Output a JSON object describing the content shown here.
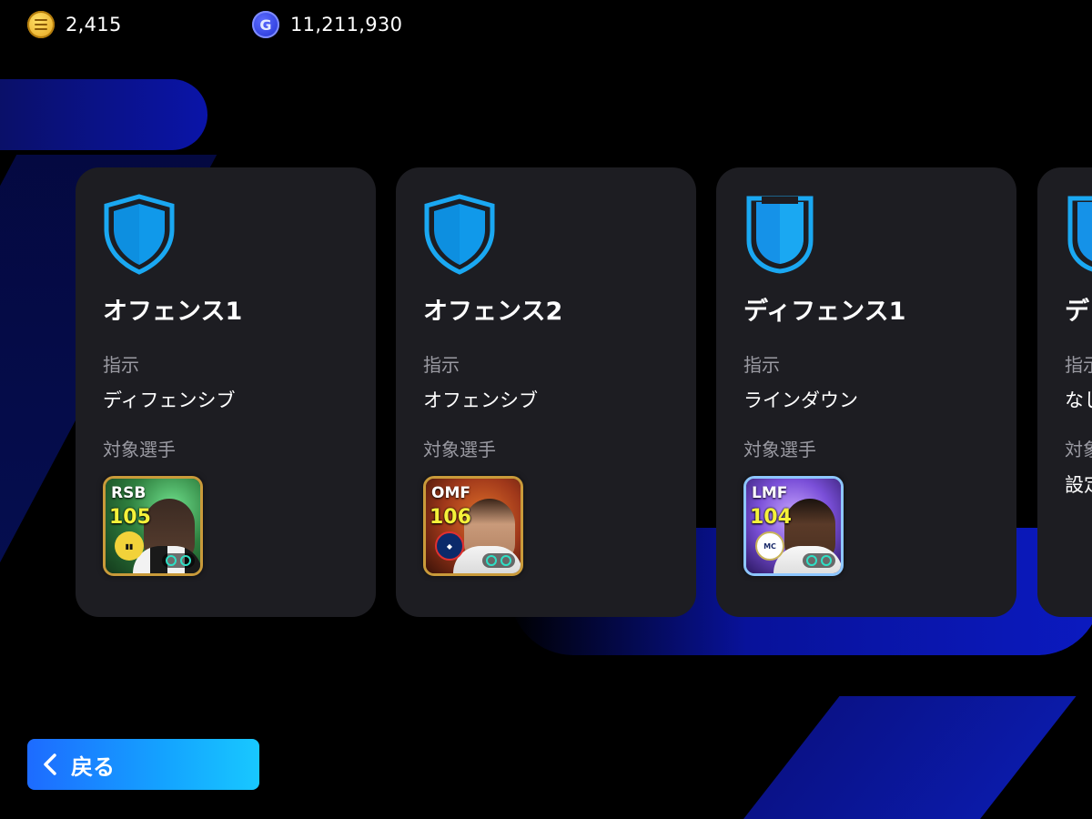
{
  "currency": {
    "coins": {
      "icon": "ecoin-icon",
      "amount": "2,415"
    },
    "gp": {
      "icon": "gp-icon",
      "amount": "11,211,930"
    }
  },
  "labels": {
    "instruction": "指示",
    "target_players": "対象選手"
  },
  "cards": [
    {
      "title": "オフェンス1",
      "shield_icon": "shield-outline-icon",
      "instruction_value": "ディフェンシブ",
      "player": {
        "position": "RSB",
        "rating": "105"
      }
    },
    {
      "title": "オフェンス2",
      "shield_icon": "shield-outline-icon",
      "instruction_value": "オフェンシブ",
      "player": {
        "position": "OMF",
        "rating": "106"
      }
    },
    {
      "title": "ディフェンス1",
      "shield_icon": "shield-solid-icon",
      "instruction_value": "ラインダウン",
      "player": {
        "position": "LMF",
        "rating": "104"
      }
    },
    {
      "title": "デ",
      "shield_icon": "shield-solid-icon",
      "instruction_value": "なし",
      "target_value": "設定"
    }
  ],
  "back_button": {
    "label": "戻る",
    "icon": "chevron-left-icon"
  },
  "colors": {
    "accent": "#14a4ff",
    "card_bg": "#1d1d22",
    "shield": "#1aa8f2",
    "rating": "#f5f23a"
  }
}
